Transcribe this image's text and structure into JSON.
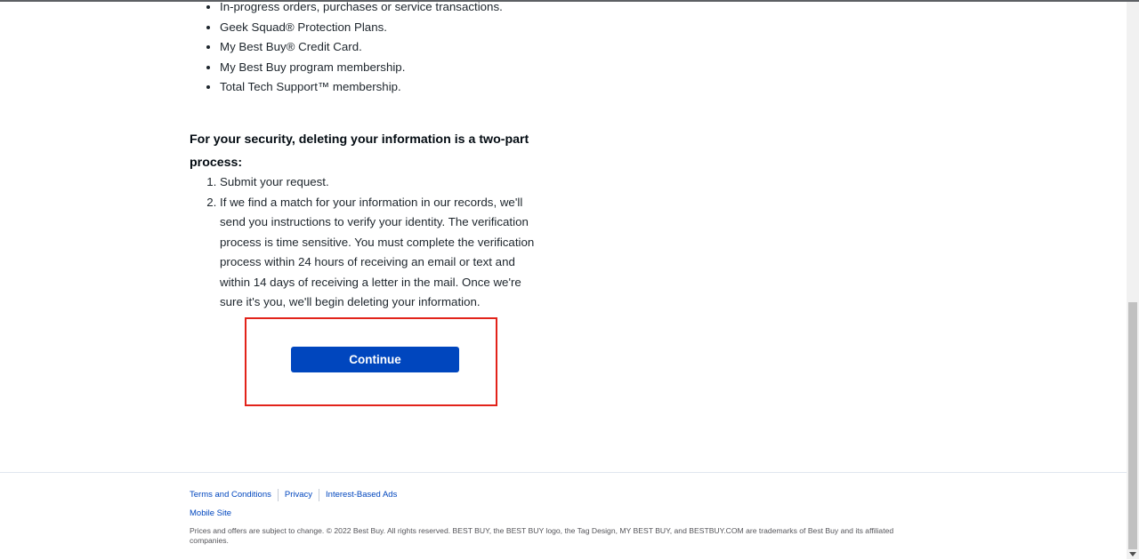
{
  "bullets": [
    "In-progress orders, purchases or service transactions.",
    "Geek Squad® Protection Plans.",
    "My Best Buy® Credit Card.",
    "My Best Buy program membership.",
    "Total Tech Support™ membership."
  ],
  "security": {
    "heading": "For your security, deleting your information is a two-part process:",
    "steps": [
      "Submit your request.",
      "If we find a match for your information in our records, we'll send you instructions to verify your identity. The verification process is time sensitive. You must complete the verification process within 24 hours of receiving an email or text and within 14 days of receiving a letter in the mail. Once we're sure it's you, we'll begin deleting your information."
    ]
  },
  "actions": {
    "continue_label": "Continue"
  },
  "footer": {
    "links": [
      "Terms and Conditions",
      "Privacy",
      "Interest-Based Ads"
    ],
    "mobile_site": "Mobile Site",
    "legal": "Prices and offers are subject to change. © 2022 Best Buy. All rights reserved. BEST BUY, the BEST BUY logo, the Tag Design, MY BEST BUY, and BESTBUY.COM are trademarks of Best Buy and its affiliated companies."
  },
  "colors": {
    "primary_button": "#0046be",
    "highlight_border": "#e2231a",
    "link": "#0046be"
  }
}
